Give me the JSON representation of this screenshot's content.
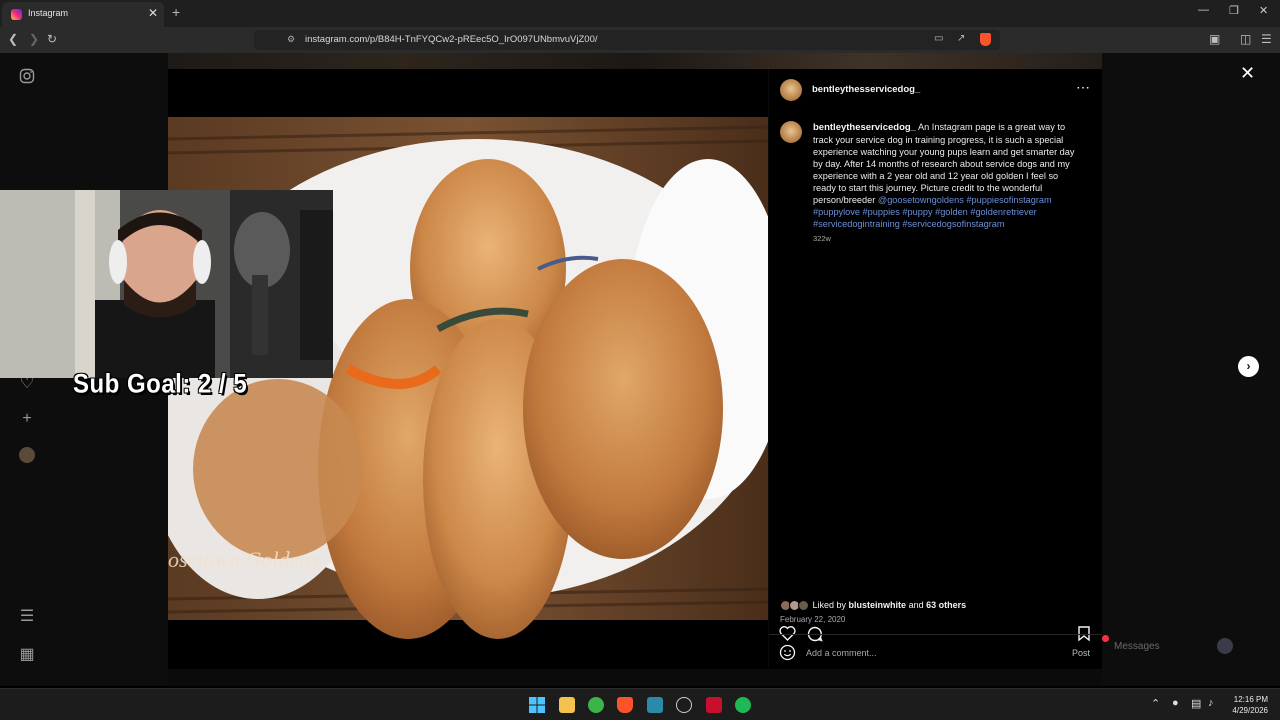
{
  "browser": {
    "tab_title": "Instagram",
    "tab_close": "✕",
    "new_tab": "+",
    "url": "instagram.com/p/B84H-TnFYQCw2-pREec5O_IrO097UNbmvuVjZ00/",
    "win_min": "—",
    "win_max": "❐",
    "win_close": "✕"
  },
  "post": {
    "username": "bentleythesservicedog_",
    "caption_user": "bentleytheservicedog_",
    "caption_text": " An Instagram page is a great way to track your service dog in training progress, it is such a special experience watching your young pups learn and get smarter day by day. After 14 months of research about service dogs and my experience with a 2 year old and 12 year old golden I feel so ready to start this journey. Picture credit to the wonderful person/breeder ",
    "caption_tags": "@goosetowngoldens #puppiesofinstagram #puppylove #puppies #puppy #golden #goldenretriever #servicedogintraining #servicedogsofinstagram",
    "age": "322w",
    "liked_by_prefix": "Liked by ",
    "liked_by_user": "blusteinwhite",
    "liked_by_mid": " and ",
    "liked_by_others": "63 others",
    "date": "February 22, 2020",
    "comment_placeholder": "Add a comment...",
    "post_label": "Post",
    "watermark": "osetown Goldens"
  },
  "messages": {
    "label": "Messages"
  },
  "overlay": {
    "sub_goal": "Sub Goal:  2 / 5"
  },
  "taskbar": {
    "time": "12:16 PM",
    "date": "4/29/2026"
  },
  "colors": {
    "link": "#6b8fd6",
    "background": "#000000",
    "ig_gradient": [
      "#f9ce34",
      "#ee2a7b",
      "#6228d7"
    ]
  }
}
